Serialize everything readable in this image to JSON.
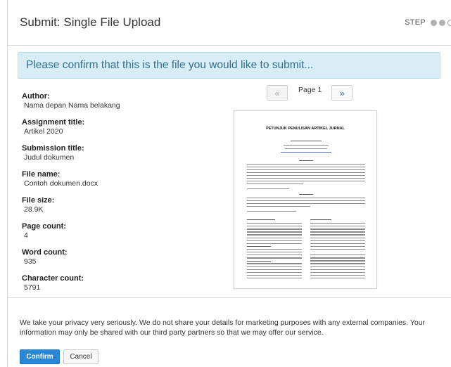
{
  "header": {
    "title": "Submit: Single File Upload",
    "step_label": "STEP",
    "step_dots": [
      "filled",
      "filled",
      "empty"
    ]
  },
  "banner": {
    "message": "Please confirm that this is the file you would like to submit..."
  },
  "metadata": [
    {
      "label": "Author:",
      "value": "Nama depan Nama belakang"
    },
    {
      "label": "Assignment title:",
      "value": "Artikel 2020"
    },
    {
      "label": "Submission title:",
      "value": "Judul dokumen"
    },
    {
      "label": "File name:",
      "value": "Contoh dokumen.docx"
    },
    {
      "label": "File size:",
      "value": "28.9K"
    },
    {
      "label": "Page count:",
      "value": "4"
    },
    {
      "label": "Word count:",
      "value": "935"
    },
    {
      "label": "Character count:",
      "value": "5791"
    }
  ],
  "pager": {
    "prev": "«",
    "next": "»",
    "page_label": "Page 1"
  },
  "preview": {
    "doc_title": "PETUNJUK PENULISAN ARTIKEL JURNAL"
  },
  "footer": {
    "privacy": "We take your privacy very seriously. We do not share your details for marketing purposes with any external companies. Your information may only be shared with our third party partners so that we may offer our service.",
    "confirm_label": "Confirm",
    "cancel_label": "Cancel"
  },
  "colors": {
    "accent": "#2a86d6",
    "banner_bg": "#d9edf7",
    "banner_text": "#31708f"
  }
}
